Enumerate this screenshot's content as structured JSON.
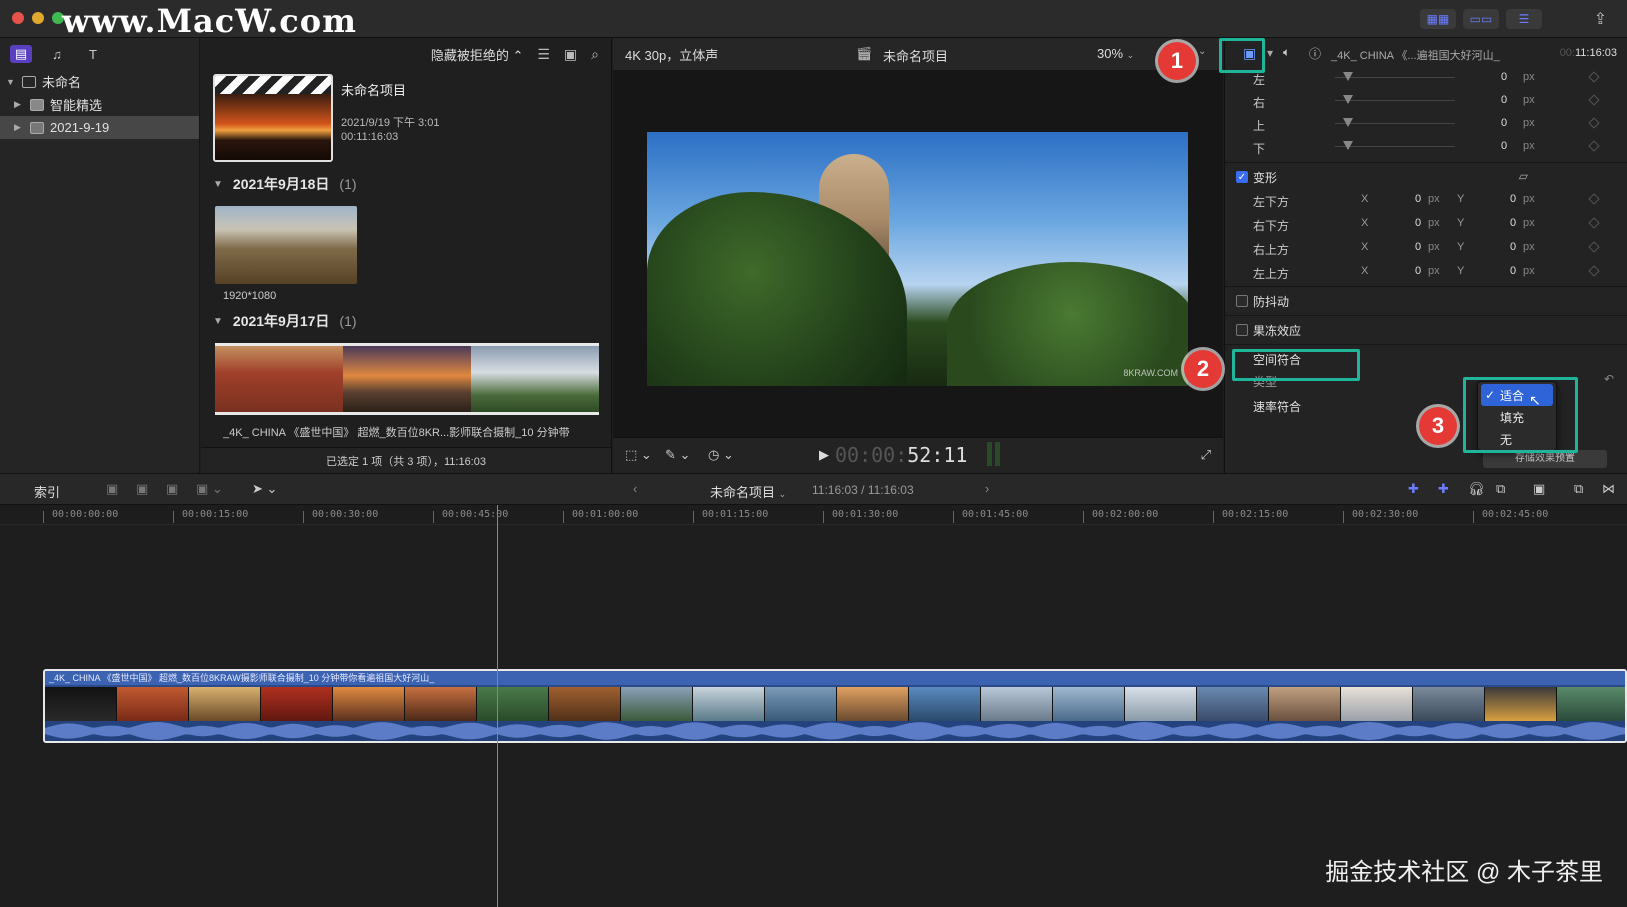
{
  "watermark_top": "www.MacW.com",
  "watermark_bottom": "掘金技术社区 @ 木子茶里",
  "library": {
    "items": [
      {
        "label": "未命名"
      },
      {
        "label": "智能精选"
      },
      {
        "label": "2021-9-19"
      }
    ]
  },
  "browser": {
    "filter_label": "隐藏被拒绝的",
    "project": {
      "title": "未命名项目",
      "date": "2021/9/19 下午 3:01",
      "duration": "00:11:16:03"
    },
    "events": [
      {
        "title": "2021年9月18日",
        "count": "(1)",
        "clip_label": "1920*1080"
      },
      {
        "title": "2021年9月17日",
        "count": "(1)",
        "clip_label": "_4K_ CHINA 《盛世中国》 超燃_数百位8KR...影师联合摄制_10 分钟带"
      }
    ],
    "status": "已选定 1 项（共 3 项），11:16:03"
  },
  "viewer": {
    "format": "4K 30p，立体声",
    "project_name": "未命名项目",
    "zoom": "30%",
    "image_watermark": "8KRAW.COM",
    "timecode_dim": "00:00:",
    "timecode_bright": "52:11"
  },
  "inspector": {
    "clip_name": "_4K_ CHINA 《...遍祖国大好河山_",
    "duration_dim": "00:",
    "duration": "11:16:03",
    "crop_rows": [
      {
        "label": "左",
        "value": "0",
        "unit": "px"
      },
      {
        "label": "右",
        "value": "0",
        "unit": "px"
      },
      {
        "label": "上",
        "value": "0",
        "unit": "px"
      },
      {
        "label": "下",
        "value": "0",
        "unit": "px"
      }
    ],
    "transform_label": "变形",
    "transform_rows": [
      {
        "label": "左下方",
        "x_label": "X",
        "x": "0",
        "x_unit": "px",
        "y_label": "Y",
        "y": "0",
        "y_unit": "px"
      },
      {
        "label": "右下方",
        "x_label": "X",
        "x": "0",
        "x_unit": "px",
        "y_label": "Y",
        "y": "0",
        "y_unit": "px"
      },
      {
        "label": "右上方",
        "x_label": "X",
        "x": "0",
        "x_unit": "px",
        "y_label": "Y",
        "y": "0",
        "y_unit": "px"
      },
      {
        "label": "左上方",
        "x_label": "X",
        "x": "0",
        "x_unit": "px",
        "y_label": "Y",
        "y": "0",
        "y_unit": "px"
      }
    ],
    "stabilization_label": "防抖动",
    "rolling_shutter_label": "果冻效应",
    "spatial_conform_label": "空间符合",
    "type_label": "类型",
    "rate_conform_label": "速率符合",
    "save_preset_label": "存储效果预置",
    "fit_menu": {
      "options": [
        "适合",
        "填充",
        "无"
      ],
      "selected": "适合"
    }
  },
  "timeline": {
    "index_label": "索引",
    "project_name": "未命名项目",
    "position": "11:16:03 / 11:16:03",
    "ruler": [
      "00:00:00:00",
      "00:00:15:00",
      "00:00:30:00",
      "00:00:45:00",
      "00:01:00:00",
      "00:01:15:00",
      "00:01:30:00",
      "00:01:45:00",
      "00:02:00:00",
      "00:02:15:00",
      "00:02:30:00",
      "00:02:45:00"
    ],
    "clip_title": "_4K_ CHINA 《盛世中国》 超燃_数百位8KRAW摄影师联合摄制_10 分钟带你看遍祖国大好河山_"
  },
  "annotations": {
    "badges": [
      "1",
      "2",
      "3"
    ],
    "highlight_color": "#1fb59a",
    "badge_color": "#e53935"
  },
  "colors": {
    "accent_blue": "#2f63d8",
    "clip_blue": "#3c62b2"
  }
}
